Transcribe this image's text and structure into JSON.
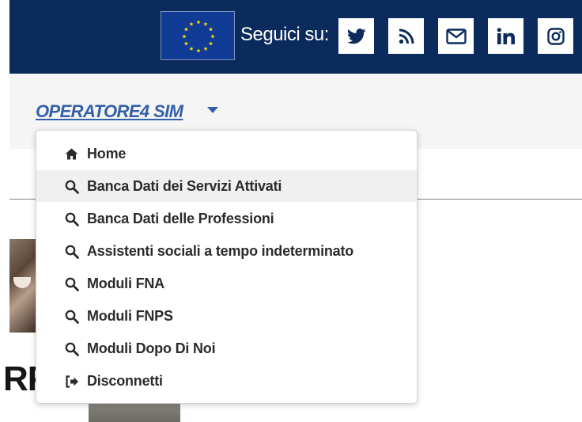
{
  "header": {
    "follow_label": "Seguici su:",
    "background_color": "#0b2b5c",
    "eu_flag": {
      "icon": "eu-flag-icon",
      "color": "#103c96",
      "star_color": "#ffdd00"
    },
    "social": [
      {
        "name": "twitter",
        "icon": "twitter-icon",
        "color": "#0b2b5c"
      },
      {
        "name": "rss",
        "icon": "rss-icon",
        "color": "#0b2b5c"
      },
      {
        "name": "email",
        "icon": "mail-icon",
        "color": "#0b2b5c"
      },
      {
        "name": "linkedin",
        "icon": "linkedin-icon",
        "color": "#0b2b5c"
      },
      {
        "name": "instagram",
        "icon": "instagram-icon",
        "color": "#0b2b5c"
      }
    ]
  },
  "user_menu": {
    "username": "OPERATORE4 SIM",
    "link_color": "#3460a8",
    "caret_icon": "caret-down-icon",
    "items": [
      {
        "label": "Home",
        "icon": "home-icon",
        "active": false
      },
      {
        "label": "Banca Dati dei Servizi Attivati",
        "icon": "search-icon",
        "active": true
      },
      {
        "label": "Banca Dati delle Professioni",
        "icon": "search-icon",
        "active": false
      },
      {
        "label": "Assistenti sociali a tempo indeterminato",
        "icon": "search-icon",
        "active": false
      },
      {
        "label": "Moduli FNA",
        "icon": "search-icon",
        "active": false
      },
      {
        "label": "Moduli FNPS",
        "icon": "search-icon",
        "active": false
      },
      {
        "label": "Moduli Dopo Di Noi",
        "icon": "search-icon",
        "active": false
      },
      {
        "label": "Disconnetti",
        "icon": "sign-out-icon",
        "active": false
      }
    ]
  },
  "background": {
    "partial_heading": "RP"
  }
}
